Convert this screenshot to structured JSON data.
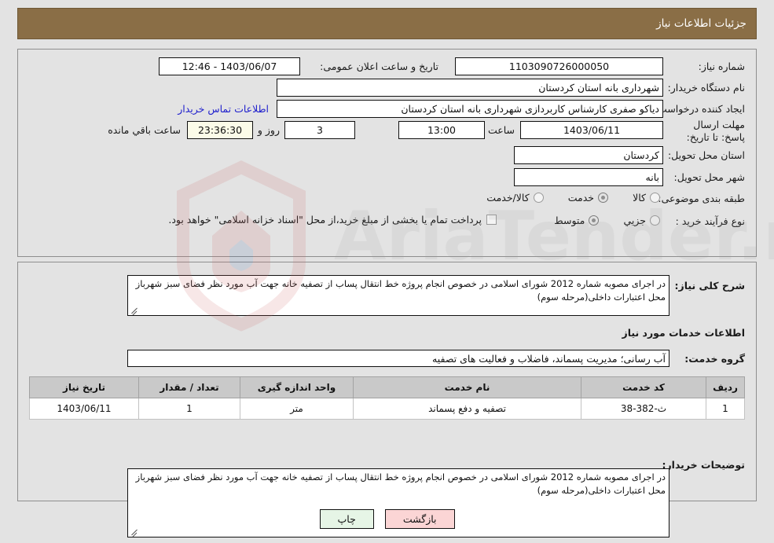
{
  "header": {
    "title": "جزئیات اطلاعات نیاز"
  },
  "top": {
    "need_number_label": "شماره نیاز:",
    "need_number_value": "1103090726000050",
    "announce_label": "تاریخ و ساعت اعلان عمومی:",
    "announce_value": "1403/06/07 - 12:46",
    "buyer_org_label": "نام دستگاه خریدار:",
    "buyer_org_value": "شهرداری بانه استان کردستان",
    "requester_label": "ایجاد کننده درخواست:",
    "requester_value": "دیاکو صفری کارشناس کاربردازی شهرداری بانه استان کردستان",
    "contact_link": "اطلاعات تماس خریدار",
    "deadline_label": "مهلت ارسال پاسخ: تا تاریخ:",
    "deadline_date": "1403/06/11",
    "hour_label": "ساعت",
    "deadline_time": "13:00",
    "days_value": "3",
    "days_label": "روز و",
    "countdown_value": "23:36:30",
    "countdown_label": "ساعت باقي مانده",
    "province_label": "استان محل تحویل:",
    "province_value": "کردستان",
    "city_label": "شهر محل تحویل:",
    "city_value": "بانه",
    "category_label": "طبقه بندی موضوعی:",
    "category_options": [
      {
        "label": "کالا",
        "selected": false
      },
      {
        "label": "خدمت",
        "selected": true
      },
      {
        "label": "کالا/خدمت",
        "selected": false
      }
    ],
    "process_label": "نوع فرآیند خرید :",
    "process_options": [
      {
        "label": "جزیي",
        "selected": false
      },
      {
        "label": "متوسط",
        "selected": true
      }
    ],
    "treasury_checkbox_label": "پرداخت تمام یا بخشی از مبلغ خرید،از محل \"اسناد خزانه اسلامی\" خواهد بود.",
    "treasury_checked": false
  },
  "mid": {
    "summary_label": "شرح کلی نیاز:",
    "summary_value": "در اجرای مصوبه شماره 2012 شورای اسلامی در خصوص انجام پروژه خط انتقال پساب از تصفیه خانه جهت آب مورد نظر فضای سبز شهرباز محل اعتبارات داخلی(مرحله سوم)",
    "services_heading": "اطلاعات خدمات مورد نیاز",
    "service_group_label": "گروه خدمت:",
    "service_group_value": "آب رسانی؛ مدیریت پسماند، فاضلاب و فعالیت های تصفیه",
    "table": {
      "columns": [
        "ردیف",
        "کد خدمت",
        "نام خدمت",
        "واحد اندازه گیری",
        "تعداد / مقدار",
        "تاریخ نیاز"
      ],
      "rows": [
        [
          "1",
          "ث-382-38",
          "تصفیه و دفع پسماند",
          "متر",
          "1",
          "1403/06/11"
        ]
      ]
    },
    "buyer_notes_label": "توضیحات خریدار:",
    "buyer_notes_value": "در اجرای مصوبه شماره 2012 شورای اسلامی در خصوص انجام پروژه خط انتقال پساب از تصفیه خانه جهت آب مورد نظر فضای سبز شهرباز محل اعتبارات داخلی(مرحله سوم)"
  },
  "footer": {
    "print_label": "چاپ",
    "back_label": "بازگشت"
  },
  "watermark": {
    "text": "AriaTender.net"
  },
  "colors": {
    "header_bg": "#8a6e46",
    "page_bg": "#e3e3e3",
    "link": "#2020cd",
    "print_btn": "#e6f5e6",
    "back_btn": "#fbd5d5",
    "countdown_bg": "#fbfbe8",
    "table_header_bg": "#c9c9c9"
  }
}
